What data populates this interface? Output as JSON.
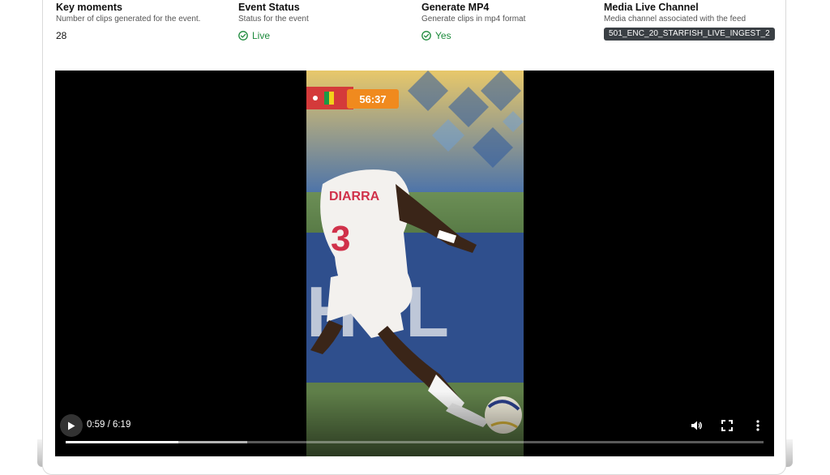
{
  "stats": [
    {
      "title": "Key moments",
      "desc": "Number of clips generated for the event.",
      "value": "28"
    },
    {
      "title": "Event Status",
      "desc": "Status for the event",
      "value": "Live",
      "icon": "check-circle-icon",
      "color": "#1d8a3c"
    },
    {
      "title": "Generate MP4",
      "desc": "Generate clips in mp4 format",
      "value": "Yes",
      "icon": "check-circle-icon",
      "color": "#1d8a3c"
    },
    {
      "title": "Media Live Channel",
      "desc": "Media channel associated with the feed",
      "value": "501_ENC_20_STARFISH_LIVE_INGEST_2"
    }
  ],
  "player": {
    "time": "0:59 / 6:19",
    "played_fraction": 0.162,
    "buffered_fraction": 0.26,
    "scorebug_clock": "56:37",
    "jersey_name": "DIARRA",
    "jersey_number": "3",
    "board_text": "HYL",
    "icons": [
      "play-icon",
      "volume-icon",
      "fullscreen-icon",
      "more-vertical-icon"
    ]
  }
}
